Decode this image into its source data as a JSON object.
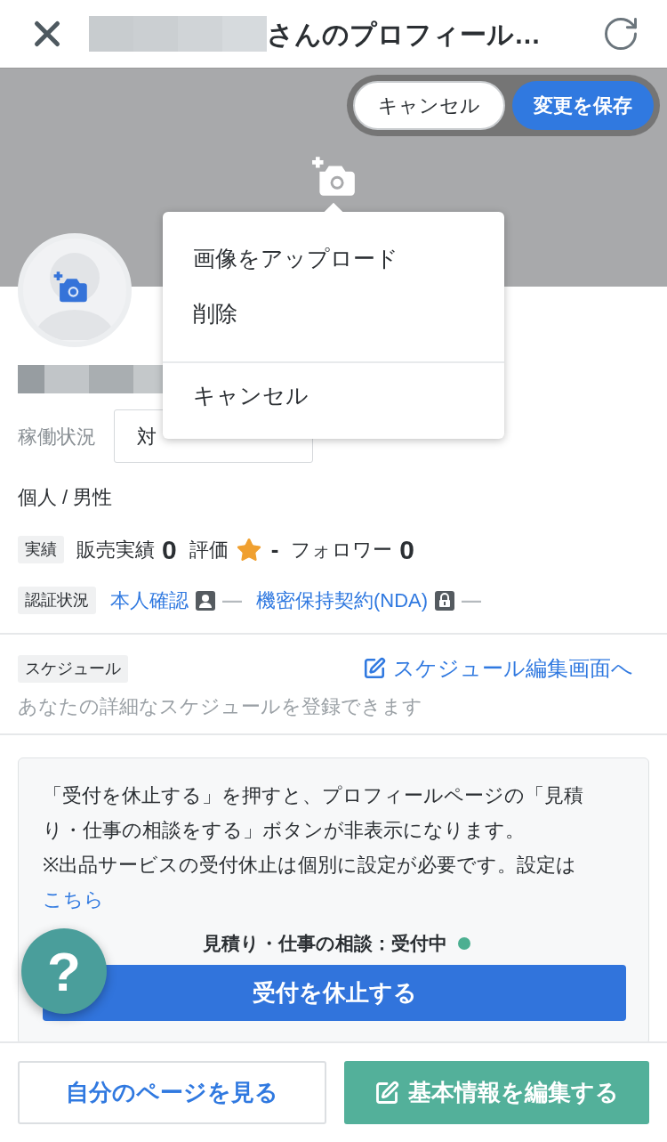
{
  "header": {
    "title": "さんのプロフィール…"
  },
  "cover": {
    "buttons": [
      {
        "label": "キャンセル",
        "kind": "secondary"
      },
      {
        "label": "変更を保存",
        "kind": "primary"
      }
    ]
  },
  "menu": {
    "items": [
      {
        "label": "画像をアップロード",
        "kind": "action"
      },
      {
        "label": "削除",
        "kind": "action"
      },
      {
        "label": "キャンセル",
        "kind": "cancel"
      }
    ]
  },
  "profile": {
    "availability": {
      "label": "稼働状況",
      "value": "対"
    },
    "attributes": "個人 / 男性",
    "stats": {
      "tag": "実績",
      "items": [
        {
          "label": "販売実績",
          "value": "0",
          "kind": "count"
        },
        {
          "label": "評価",
          "value": "-",
          "kind": "rating"
        },
        {
          "label": "フォロワー",
          "value": "0",
          "kind": "count"
        }
      ]
    },
    "verification": {
      "tag": "認証状況",
      "items": [
        {
          "label": "本人確認",
          "kind": "identity",
          "status": "—"
        },
        {
          "label": "機密保持契約(NDA)",
          "kind": "nda",
          "status": "—"
        }
      ]
    }
  },
  "schedule": {
    "tag": "スケジュール",
    "link": "スケジュール編集画面へ",
    "description": "あなたの詳細なスケジュールを登録できます"
  },
  "notice": {
    "lines": [
      "「受付を休止する」を押すと、プロフィールページの「見積り・仕事の相談をする」ボタンが非表示になります。",
      "※出品サービスの受付休止は個別に設定が必要です。設定は"
    ],
    "link": "こちら",
    "status": "見積り・仕事の相談：受付中",
    "button": "受付を休止する"
  },
  "footer": {
    "buttons": [
      {
        "label": "自分のページを見る",
        "kind": "outline"
      },
      {
        "label": "基本情報を編集する",
        "kind": "primary"
      }
    ]
  },
  "help": {
    "label": "?"
  }
}
